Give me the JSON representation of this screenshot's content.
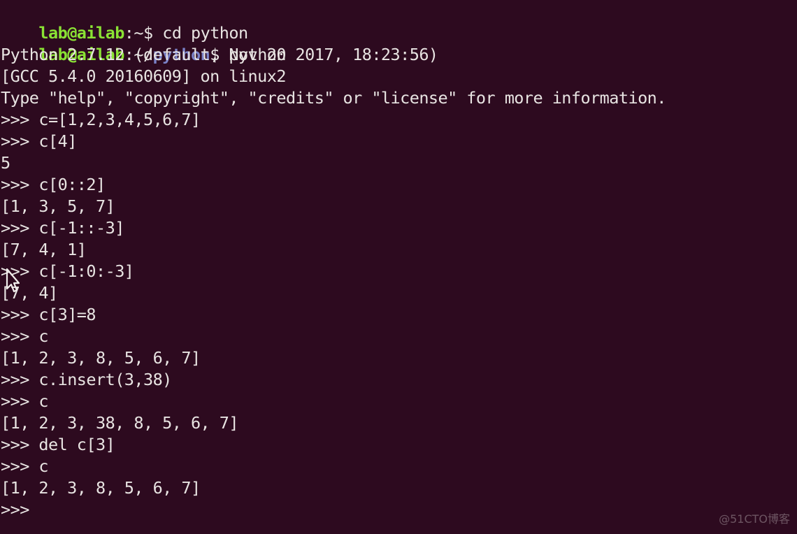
{
  "terminal": {
    "background_color": "#2d0a1f",
    "foreground_color": "#e8e4e2",
    "prompt_user_host_color": "#8ae234",
    "prompt_path_color": "#7a82c8",
    "shell_prompt_user": "lab@ailab",
    "lines": [
      {
        "type": "shell-prompt",
        "user": "lab@ailab",
        "colon": ":",
        "path": "~",
        "path_colored": false,
        "sigil": "$ ",
        "command": "cd python"
      },
      {
        "type": "shell-prompt",
        "user": "lab@ailab",
        "colon": ":",
        "path_prefix": "~/",
        "path": "python",
        "path_colored": true,
        "sigil": "$ ",
        "command": "python"
      },
      {
        "type": "output",
        "text": "Python 2.7.12 (default, Nov 20 2017, 18:23:56)"
      },
      {
        "type": "output",
        "text": "[GCC 5.4.0 20160609] on linux2"
      },
      {
        "type": "output",
        "text": "Type \"help\", \"copyright\", \"credits\" or \"license\" for more information."
      },
      {
        "type": "py-input",
        "prompt": ">>> ",
        "text": "c=[1,2,3,4,5,6,7]"
      },
      {
        "type": "py-input",
        "prompt": ">>> ",
        "text": "c[4]"
      },
      {
        "type": "output",
        "text": "5"
      },
      {
        "type": "py-input",
        "prompt": ">>> ",
        "text": "c[0::2]"
      },
      {
        "type": "output",
        "text": "[1, 3, 5, 7]"
      },
      {
        "type": "py-input",
        "prompt": ">>> ",
        "text": "c[-1::-3]"
      },
      {
        "type": "output",
        "text": "[7, 4, 1]"
      },
      {
        "type": "py-input",
        "prompt": ">>> ",
        "text": "c[-1:0:-3]"
      },
      {
        "type": "output",
        "text": "[7, 4]"
      },
      {
        "type": "py-input",
        "prompt": ">>> ",
        "text": "c[3]=8"
      },
      {
        "type": "py-input",
        "prompt": ">>> ",
        "text": "c"
      },
      {
        "type": "output",
        "text": "[1, 2, 3, 8, 5, 6, 7]"
      },
      {
        "type": "py-input",
        "prompt": ">>> ",
        "text": "c.insert(3,38)"
      },
      {
        "type": "py-input",
        "prompt": ">>> ",
        "text": "c"
      },
      {
        "type": "output",
        "text": "[1, 2, 3, 38, 8, 5, 6, 7]"
      },
      {
        "type": "py-input",
        "prompt": ">>> ",
        "text": "del c[3]"
      },
      {
        "type": "py-input",
        "prompt": ">>> ",
        "text": "c"
      },
      {
        "type": "output",
        "text": "[1, 2, 3, 8, 5, 6, 7]"
      },
      {
        "type": "py-input",
        "prompt": ">>>",
        "text": ""
      }
    ]
  },
  "watermark": {
    "text": "@51CTO博客"
  },
  "cursor": {
    "icon": "text-cursor-pointer"
  },
  "line_index": {
    "l0": 0,
    "l1": 1,
    "l2": 2,
    "l3": 3,
    "l4": 4,
    "l5": 5,
    "l6": 6,
    "l7": 7,
    "l8": 8,
    "l9": 9,
    "l10": 10,
    "l11": 11,
    "l12": 12,
    "l13": 13,
    "l14": 14,
    "l15": 15,
    "l16": 16,
    "l17": 17,
    "l18": 18,
    "l19": 19,
    "l20": 20,
    "l21": 21,
    "l22": 22,
    "l23": 23
  }
}
